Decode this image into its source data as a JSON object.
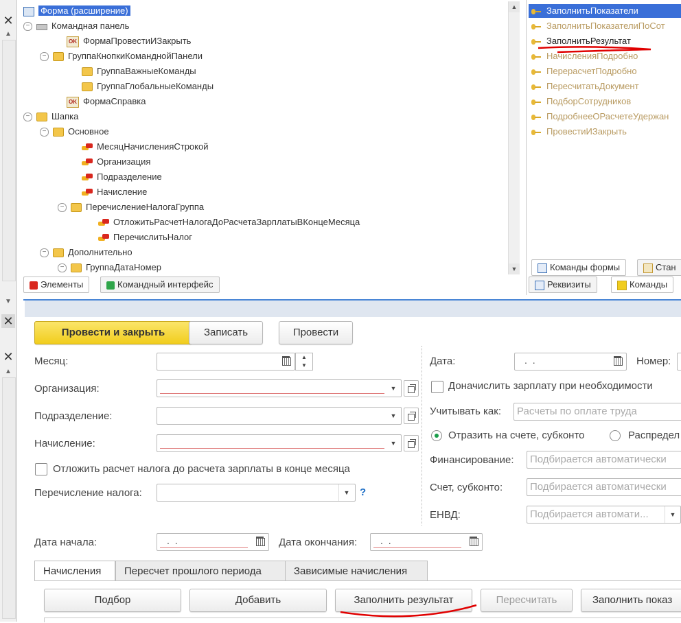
{
  "tree": {
    "nodes": [
      {
        "label": "Форма (расширение)",
        "icon": "form-icon",
        "toggle": "",
        "selected": true
      },
      {
        "label": "Командная панель",
        "icon": "command-panel-icon",
        "toggle": "⊖"
      },
      {
        "label": "ФормаПровестиИЗакрыть",
        "icon": "ok-button-icon",
        "toggle": ""
      },
      {
        "label": "ГруппаКнопкиКоманднойПанели",
        "icon": "folder-icon",
        "toggle": "⊖"
      },
      {
        "label": "ГруппаВажныеКоманды",
        "icon": "folder-icon",
        "toggle": ""
      },
      {
        "label": "ГруппаГлобальныеКоманды",
        "icon": "folder-icon",
        "toggle": ""
      },
      {
        "label": "ФормаСправка",
        "icon": "ok-button-icon",
        "toggle": ""
      },
      {
        "label": "Шапка",
        "icon": "folder-icon",
        "toggle": "⊖"
      },
      {
        "label": "Основное",
        "icon": "folder-icon",
        "toggle": "⊖"
      },
      {
        "label": "МесяцНачисленияСтрокой",
        "icon": "field-icon",
        "toggle": ""
      },
      {
        "label": "Организация",
        "icon": "field-icon",
        "toggle": ""
      },
      {
        "label": "Подразделение",
        "icon": "field-icon",
        "toggle": ""
      },
      {
        "label": "Начисление",
        "icon": "field-icon",
        "toggle": ""
      },
      {
        "label": "ПеречислениеНалогаГруппа",
        "icon": "folder-icon",
        "toggle": "⊖"
      },
      {
        "label": "ОтложитьРасчетНалогаДоРасчетаЗарплатыВКонцеМесяца",
        "icon": "field-icon",
        "toggle": ""
      },
      {
        "label": "ПеречислитьНалог",
        "icon": "field-icon",
        "toggle": ""
      },
      {
        "label": "Дополнительно",
        "icon": "folder-icon",
        "toggle": "⊖"
      },
      {
        "label": "ГруппаДатаНомер",
        "icon": "folder-icon",
        "toggle": "⊖"
      }
    ],
    "tabs": [
      "Элементы",
      "Командный интерфейс"
    ]
  },
  "commands": {
    "items": [
      "ЗаполнитьПоказатели",
      "ЗаполнитьПоказателиПоСот",
      "ЗаполнитьРезультат",
      "НачисленияПодробно",
      "ПерерасчетПодробно",
      "ПересчитатьДокумент",
      "ПодборСотрудников",
      "ПодробнееОРасчетеУдержан",
      "ПровестиИЗакрыть"
    ],
    "tabs": [
      "Команды формы",
      "Стан"
    ],
    "bottom_tabs": [
      "Реквизиты",
      "Команды"
    ]
  },
  "form": {
    "buttons": {
      "post_close": "Провести и закрыть",
      "save": "Записать",
      "post": "Провести"
    },
    "labels": {
      "month": "Месяц:",
      "organization": "Организация:",
      "department": "Подразделение:",
      "accrual": "Начисление:",
      "defer_tax": "Отложить расчет налога до расчета зарплаты в конце месяца",
      "tax_transfer": "Перечисление налога:",
      "help": "?",
      "date": "Дата:",
      "number": "Номер:",
      "accrue_if_needed": "Доначислить зарплату при необходимости",
      "account_as": "Учитывать как:",
      "reflect_account": "Отразить на счете, субконто",
      "distribute": "Распредел",
      "financing": "Финансирование:",
      "account_subconto": "Счет, субконто:",
      "envd": "ЕНВД:",
      "start_date": "Дата начала:",
      "end_date": "Дата окончания:"
    },
    "placeholders": {
      "account_as": "Расчеты по оплате труда",
      "financing": "Подбирается автоматически",
      "account_subconto": "Подбирается автоматически",
      "envd": "Подбирается автомати..."
    },
    "date_empty": ". .",
    "tabs": [
      "Начисления",
      "Пересчет прошлого периода",
      "Зависимые начисления"
    ],
    "table_buttons": [
      "Подбор",
      "Добавить",
      "Заполнить результат",
      "Пересчитать",
      "Заполнить показ"
    ]
  },
  "colors": {
    "accent": "#3a6fd8",
    "primary_button": "#f1cd1d",
    "annotation": "#e00000"
  }
}
